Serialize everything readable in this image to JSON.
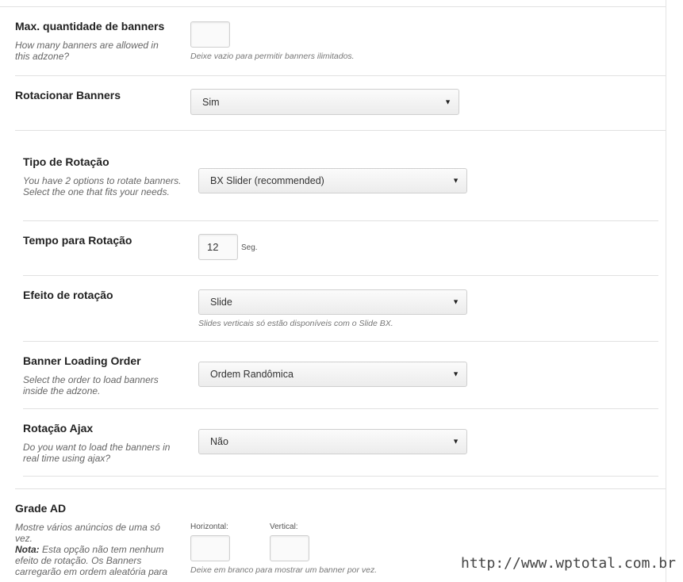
{
  "max_banners": {
    "label": "Max. quantidade de banners",
    "desc": "How many banners are allowed in this adzone?",
    "value": "",
    "hint": "Deixe vazio para permitir banners ilimitados."
  },
  "rotate": {
    "label": "Rotacionar Banners",
    "selected": "Sim"
  },
  "rotation_type": {
    "label": "Tipo de Rotação",
    "desc": "You have 2 options to rotate banners. Select the one that fits your needs.",
    "selected": "BX Slider (recommended)"
  },
  "rotation_time": {
    "label": "Tempo para Rotação",
    "value": "12",
    "unit": "Seg."
  },
  "rotation_effect": {
    "label": "Efeito de rotação",
    "selected": "Slide",
    "hint": "Slides verticais só estão disponíveis com o Slide BX."
  },
  "loading_order": {
    "label": "Banner Loading Order",
    "desc": "Select the order to load banners inside the adzone.",
    "selected": "Ordem Randômica"
  },
  "ajax": {
    "label": "Rotação Ajax",
    "desc": "Do you want to load the banners in real time using ajax?",
    "selected": "Não"
  },
  "grid": {
    "label": "Grade AD",
    "desc": "Mostre vários anúncios de uma só vez.",
    "note_label": "Nota:",
    "note_text": " Esta opção não tem nenhum efeito de rotação. Os Banners carregarão em ordem aleatória para",
    "horizontal_label": "Horizontal:",
    "vertical_label": "Vertical:",
    "horizontal_value": "",
    "vertical_value": "",
    "hint": "Deixe em branco para mostrar um banner por vez."
  },
  "watermark": "http://www.wptotal.com.br"
}
